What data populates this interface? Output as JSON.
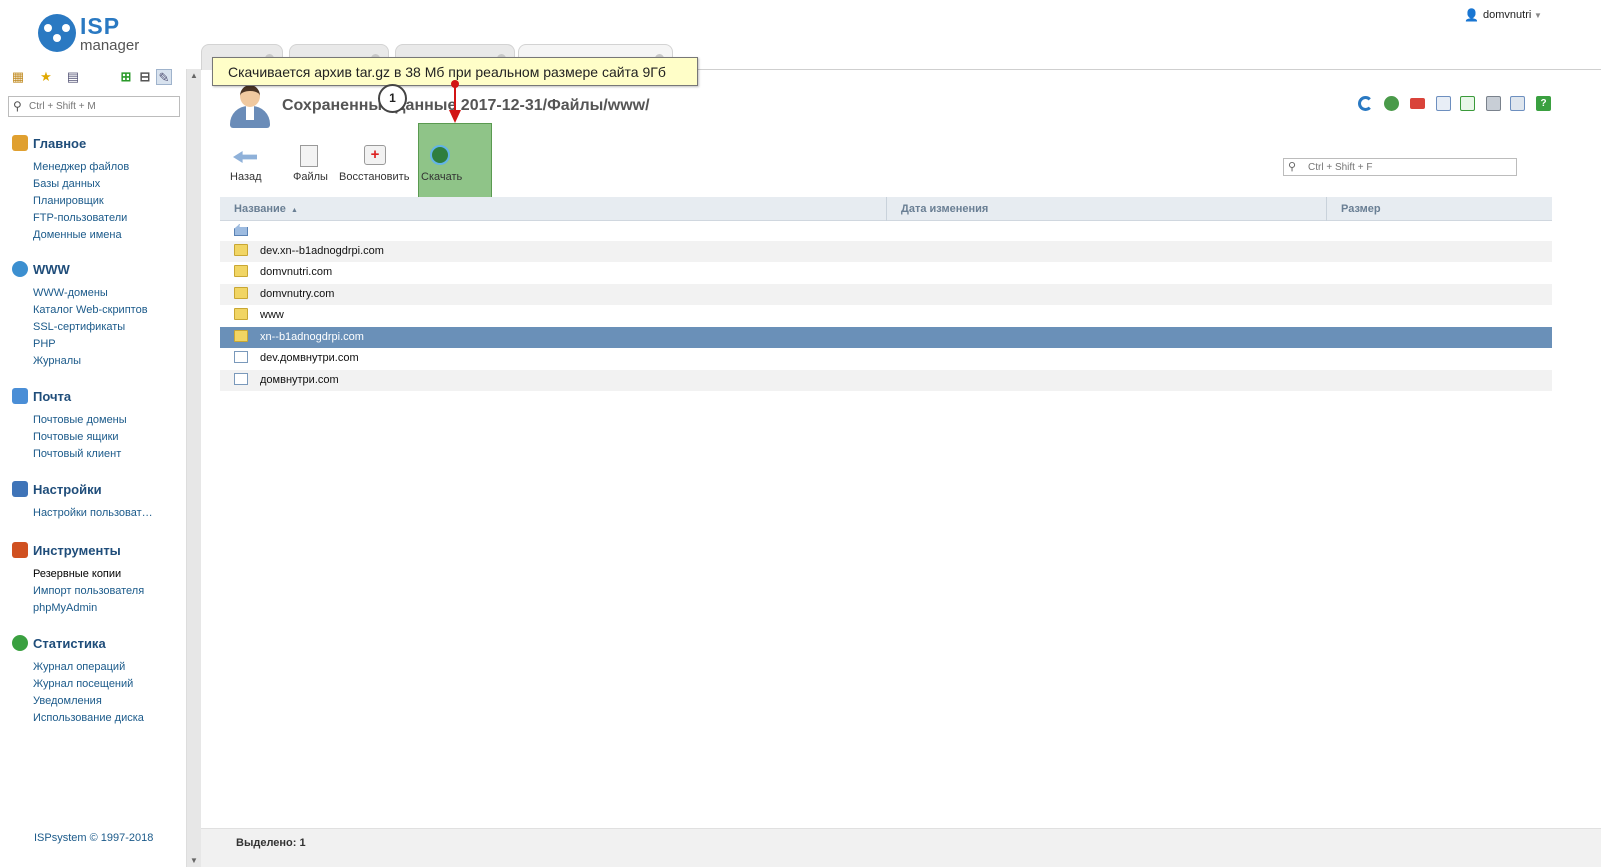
{
  "app": {
    "logo_text_top": "ISP",
    "logo_text_bottom": "manager"
  },
  "user": {
    "name": "domvnutri"
  },
  "sidebar": {
    "search_placeholder": "Ctrl + Shift + M",
    "groups": [
      {
        "title": "Главное",
        "icon": "home-icon",
        "color": "#e0a030",
        "items": [
          "Менеджер файлов",
          "Базы данных",
          "Планировщик",
          "FTP-пользователи",
          "Доменные имена"
        ]
      },
      {
        "title": "WWW",
        "icon": "globe-icon",
        "color": "#3c8fd0",
        "items": [
          "WWW-домены",
          "Каталог Web-скриптов",
          "SSL-сертификаты",
          "PHP",
          "Журналы"
        ]
      },
      {
        "title": "Почта",
        "icon": "mail-icon",
        "color": "#4a8ed6",
        "items": [
          "Почтовые домены",
          "Почтовые ящики",
          "Почтовый клиент"
        ]
      },
      {
        "title": "Настройки",
        "icon": "monitor-icon",
        "color": "#3f74b8",
        "items": [
          "Настройки пользоват…"
        ]
      },
      {
        "title": "Инструменты",
        "icon": "tools-icon",
        "color": "#d05020",
        "items": [
          "Резервные копии",
          "Импорт пользователя",
          "phpMyAdmin"
        ]
      },
      {
        "title": "Статистика",
        "icon": "pie-chart-icon",
        "color": "#3aa040",
        "items": [
          "Журнал операций",
          "Журнал посещений",
          "Уведомления",
          "Использование диска"
        ]
      }
    ],
    "active_item": "Резервные копии",
    "copyright": "ISPsystem © 1997-2018"
  },
  "callout": {
    "text": "Скачивается архив tar.gz в 38 Мб при реальном размере сайта 9Гб",
    "number": "1"
  },
  "page": {
    "title": "Сохраненные данные 2017-12-31/Файлы/www/"
  },
  "toolbar": {
    "back": "Назад",
    "files": "Файлы",
    "restore": "Восстановить",
    "download": "Скачать",
    "search_placeholder": "Ctrl + Shift + F"
  },
  "table": {
    "columns": [
      "Название",
      "Дата изменения",
      "Размер"
    ],
    "rows": [
      {
        "name": "dev.xn--b1adnogdrpi.com",
        "type": "folder"
      },
      {
        "name": "domvnutri.com",
        "type": "folder"
      },
      {
        "name": "domvnutry.com",
        "type": "folder"
      },
      {
        "name": "www",
        "type": "folder"
      },
      {
        "name": "xn--b1adnogdrpi.com",
        "type": "folder",
        "selected": true
      },
      {
        "name": "dev.домвнутри.com",
        "type": "link"
      },
      {
        "name": "домвнутри.com",
        "type": "link"
      }
    ]
  },
  "status": {
    "label": "Выделено:",
    "count": "1"
  }
}
